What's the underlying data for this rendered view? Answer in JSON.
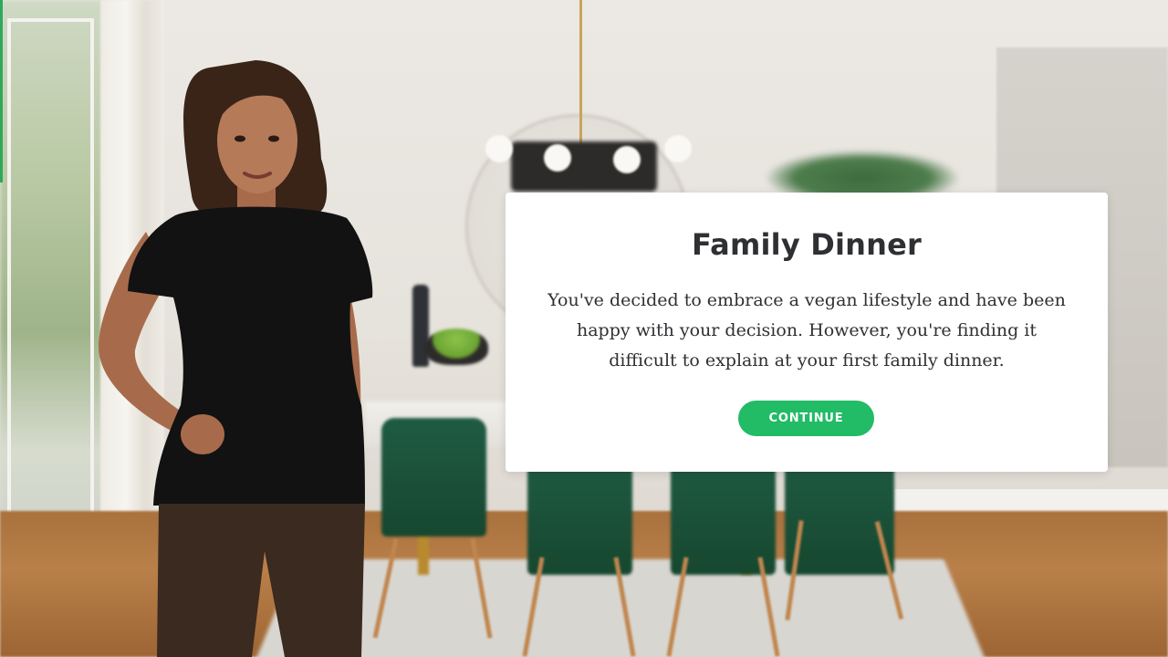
{
  "dialog": {
    "title": "Family Dinner",
    "body": "You've decided to embrace a vegan lifestyle and have been happy with your decision. However, you're finding it difficult to explain at your first family dinner.",
    "continue_label": "CONTINUE"
  },
  "colors": {
    "accent": "#22bb66",
    "dialog_background": "#ffffff",
    "text": "#2f3033"
  },
  "icons": {
    "scene": "dining-room-background",
    "character": "character-avatar"
  }
}
